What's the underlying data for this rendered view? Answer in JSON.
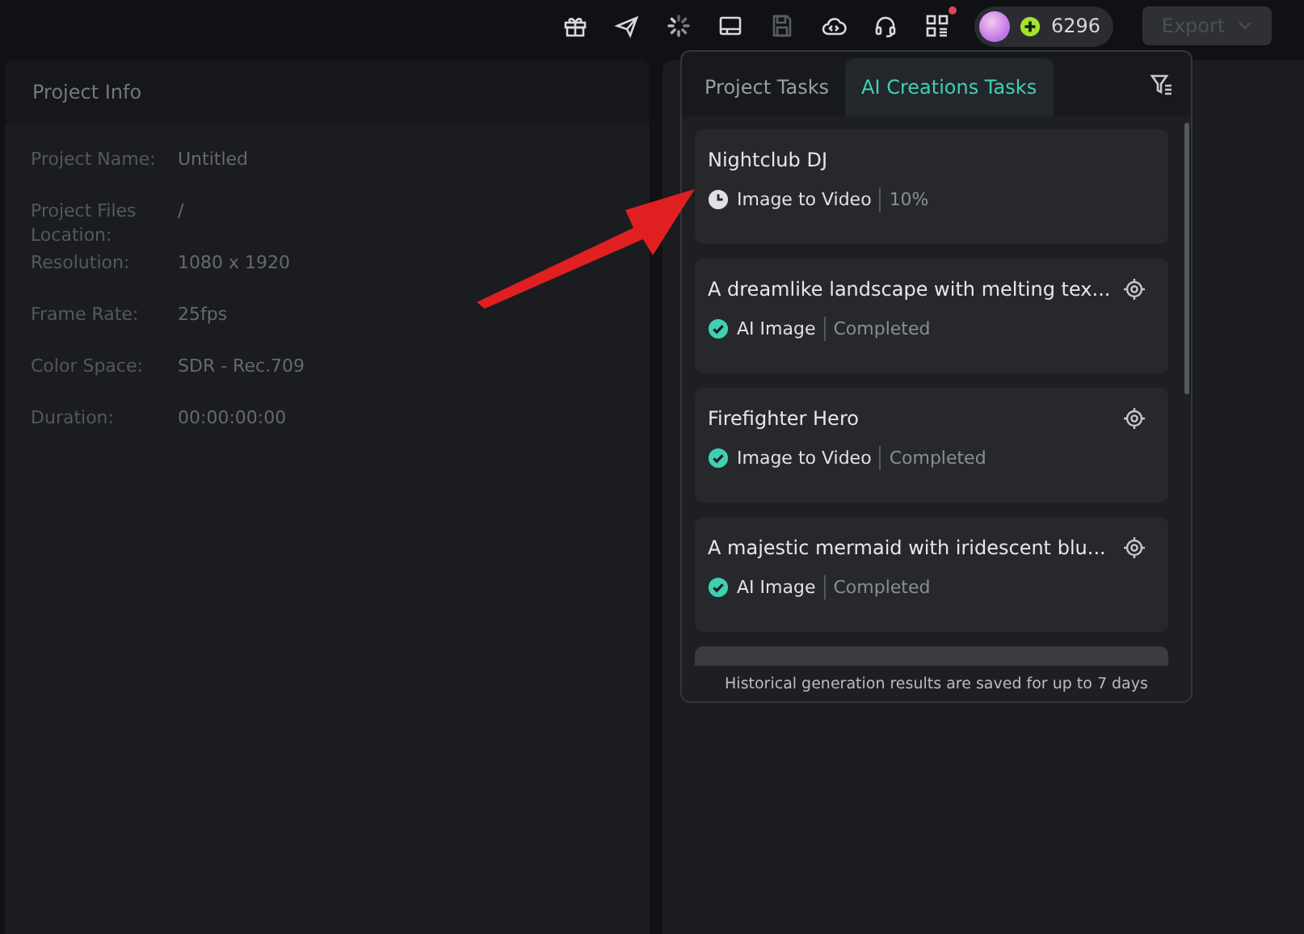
{
  "toolbar": {
    "credits": "6296",
    "export_button": {
      "label": "Export",
      "disabled": true
    },
    "notification_dot": true
  },
  "project_info": {
    "title": "Project Info",
    "fields": [
      {
        "label": "Project Name:",
        "value": "Untitled"
      },
      {
        "label": "Project Files Location:",
        "value": "/"
      },
      {
        "label": "Resolution:",
        "value": "1080 x 1920"
      },
      {
        "label": "Frame Rate:",
        "value": "25fps"
      },
      {
        "label": "Color Space:",
        "value": "SDR - Rec.709"
      },
      {
        "label": "Duration:",
        "value": "00:00:00:00"
      }
    ]
  },
  "tasks_popup": {
    "tabs": [
      {
        "label": "Project Tasks",
        "selected": false
      },
      {
        "label": "AI Creations Tasks",
        "selected": true
      }
    ],
    "tasks": [
      {
        "title": "Nightclub DJ",
        "type": "Image to Video",
        "status": "10%",
        "kind": "running"
      },
      {
        "title": "A dreamlike landscape with melting tex...",
        "type": "AI Image",
        "status": "Completed",
        "kind": "completed"
      },
      {
        "title": "Firefighter Hero",
        "type": "Image to Video",
        "status": "Completed",
        "kind": "completed"
      },
      {
        "title": "A majestic mermaid with iridescent blu...",
        "type": "AI Image",
        "status": "Completed",
        "kind": "completed"
      }
    ],
    "footer": "Historical generation results are saved for up to 7 days"
  }
}
